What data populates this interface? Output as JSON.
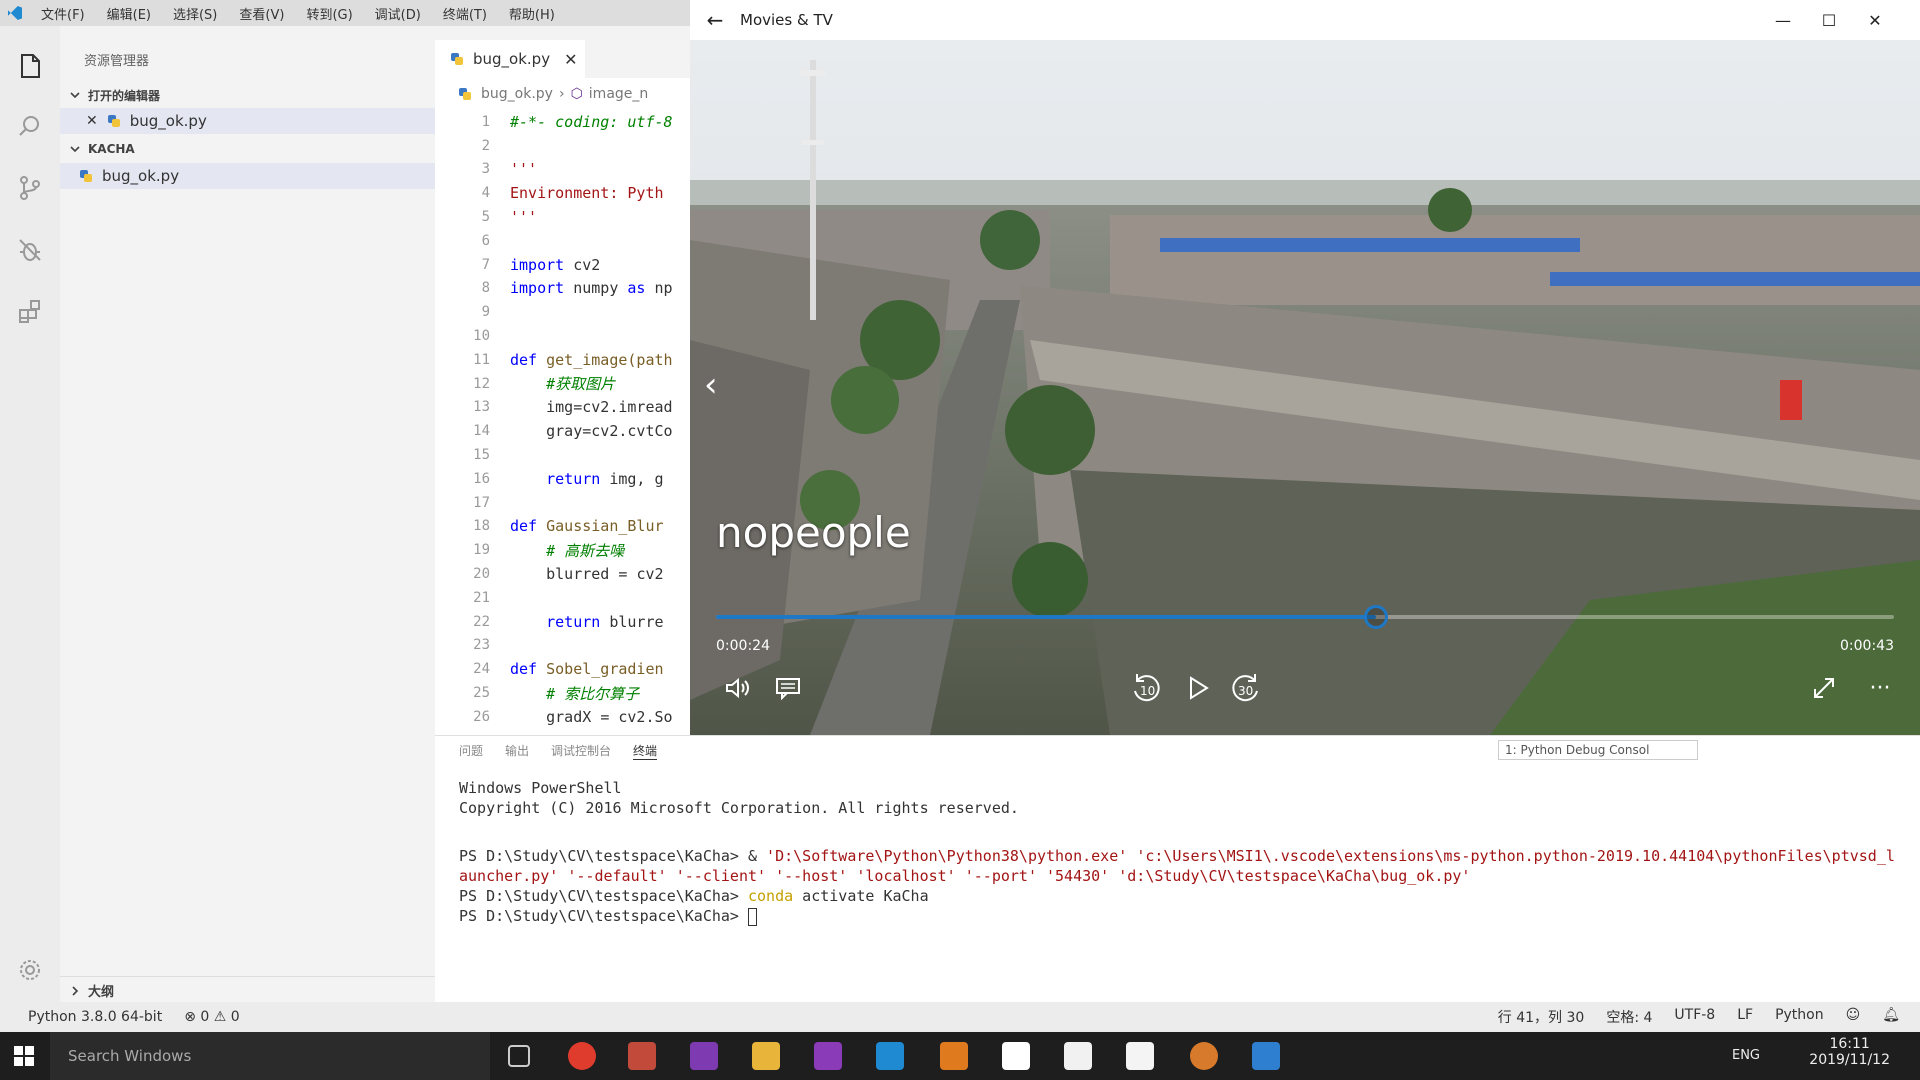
{
  "menubar": {
    "items": [
      "文件(F)",
      "编辑(E)",
      "选择(S)",
      "查看(V)",
      "转到(G)",
      "调试(D)",
      "终端(T)",
      "帮助(H)"
    ]
  },
  "sidebar": {
    "title": "资源管理器",
    "open_editors_label": "打开的编辑器",
    "open_editor_file": "bug_ok.py",
    "folder_label": "KACHA",
    "folder_file": "bug_ok.py",
    "outline_label": "大纲"
  },
  "editor": {
    "tab_label": "bug_ok.py",
    "breadcrumb": {
      "file": "bug_ok.py",
      "symbol": "image_n"
    },
    "lines": [
      {
        "n": "1",
        "t": "#-*- coding: utf-8"
      },
      {
        "n": "2",
        "t": ""
      },
      {
        "n": "3",
        "t": "'''"
      },
      {
        "n": "4",
        "t": "Environment: Pyth"
      },
      {
        "n": "5",
        "t": "'''"
      },
      {
        "n": "6",
        "t": ""
      },
      {
        "n": "7",
        "t": "import cv2"
      },
      {
        "n": "8",
        "t": "import numpy as np"
      },
      {
        "n": "9",
        "t": ""
      },
      {
        "n": "10",
        "t": ""
      },
      {
        "n": "11",
        "t": "def get_image(path"
      },
      {
        "n": "12",
        "t": "    #获取图片"
      },
      {
        "n": "13",
        "t": "    img=cv2.imread"
      },
      {
        "n": "14",
        "t": "    gray=cv2.cvtCo"
      },
      {
        "n": "15",
        "t": ""
      },
      {
        "n": "16",
        "t": "    return img, g"
      },
      {
        "n": "17",
        "t": ""
      },
      {
        "n": "18",
        "t": "def Gaussian_Blur"
      },
      {
        "n": "19",
        "t": "    # 高斯去噪"
      },
      {
        "n": "20",
        "t": "    blurred = cv2"
      },
      {
        "n": "21",
        "t": ""
      },
      {
        "n": "22",
        "t": "    return blurre"
      },
      {
        "n": "23",
        "t": ""
      },
      {
        "n": "24",
        "t": "def Sobel_gradien"
      },
      {
        "n": "25",
        "t": "    # 索比尔算子"
      },
      {
        "n": "26",
        "t": "    gradX = cv2.So"
      }
    ]
  },
  "panel": {
    "tabs": [
      "问题",
      "输出",
      "调试控制台",
      "终端"
    ],
    "terminal_selector": "1: Python Debug Consol",
    "terminal_lines": {
      "l1": "Windows PowerShell",
      "l2": "Copyright (C) 2016 Microsoft Corporation. All rights reserved.",
      "l3_prompt": "PS D:\\Study\\CV\\testspace\\KaCha> & ",
      "l3_arg1": "'D:\\Software\\Python\\Python38\\python.exe'",
      "l3_arg2": "'c:\\Users\\MSI1\\.vscode\\extensions\\ms-python.python-2019.10.44104\\pythonFiles\\ptvsd_l",
      "l4": "auncher.py' '--default' '--client' '--host' 'localhost' '--port' '54430' 'd:\\Study\\CV\\testspace\\KaCha\\bug_ok.py'",
      "l5_prompt": "PS D:\\Study\\CV\\testspace\\KaCha> ",
      "l5_cmd": "conda",
      "l5_rest": " activate KaCha",
      "l6_prompt": "PS D:\\Study\\CV\\testspace\\KaCha> "
    }
  },
  "statusbar": {
    "interpreter": "Python 3.8.0 64-bit",
    "problems": "⊗ 0 ⚠ 0",
    "position": "行 41，列 30",
    "spaces": "空格: 4",
    "encoding": "UTF-8",
    "eol": "LF",
    "language": "Python"
  },
  "taskbar": {
    "search_placeholder": "Search Windows",
    "lang": "ENG",
    "time": "16:11",
    "date": "2019/11/12"
  },
  "movies": {
    "title": "Movies & TV",
    "caption": "nopeople",
    "elapsed": "0:00:24",
    "total": "0:00:43",
    "progress_fraction": 0.56,
    "skip_back": "10",
    "skip_forward": "30",
    "more": "···"
  }
}
